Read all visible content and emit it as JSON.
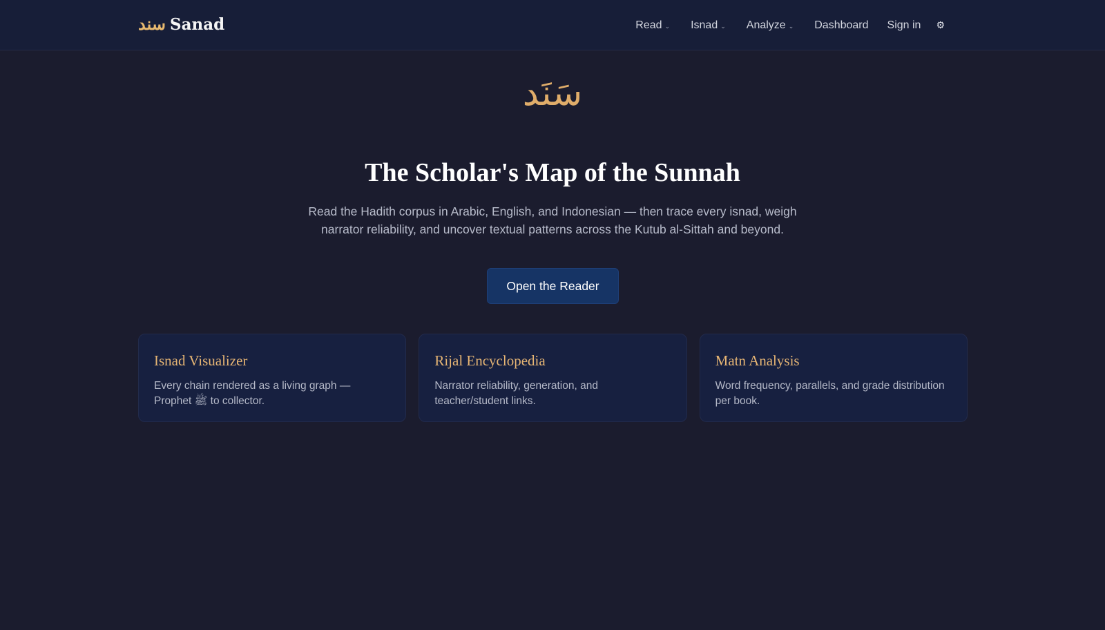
{
  "brand": {
    "arabic": "سند",
    "name": "Sanad"
  },
  "nav": {
    "items": [
      {
        "label": "Read",
        "has_dropdown": true
      },
      {
        "label": "Isnad",
        "has_dropdown": true
      },
      {
        "label": "Analyze",
        "has_dropdown": true
      },
      {
        "label": "Dashboard",
        "has_dropdown": false
      },
      {
        "label": "Sign in",
        "has_dropdown": false
      }
    ],
    "caret": "⌄",
    "settings_icon": "⚙"
  },
  "hero": {
    "logo": "سَنَد",
    "title": "The Scholar's Map of the Sunnah",
    "description": "Read the Hadith corpus in Arabic, English, and Indonesian — then trace every isnad, weigh narrator reliability, and uncover textual patterns across the Kutub al-Sittah and beyond.",
    "cta": "Open the Reader"
  },
  "features": [
    {
      "title": "Isnad Visualizer",
      "description": "Every chain rendered as a living graph — Prophet ﷺ to collector."
    },
    {
      "title": "Rijal Encyclopedia",
      "description": "Narrator reliability, generation, and teacher/student links."
    },
    {
      "title": "Matn Analysis",
      "description": "Word frequency, parallels, and grade distribution per book."
    }
  ],
  "colors": {
    "background": "#1b1c2e",
    "navbar": "#171e38",
    "accent_gold": "#e0ad6a",
    "cta_blue": "#163465",
    "card_bg": "#172040"
  }
}
